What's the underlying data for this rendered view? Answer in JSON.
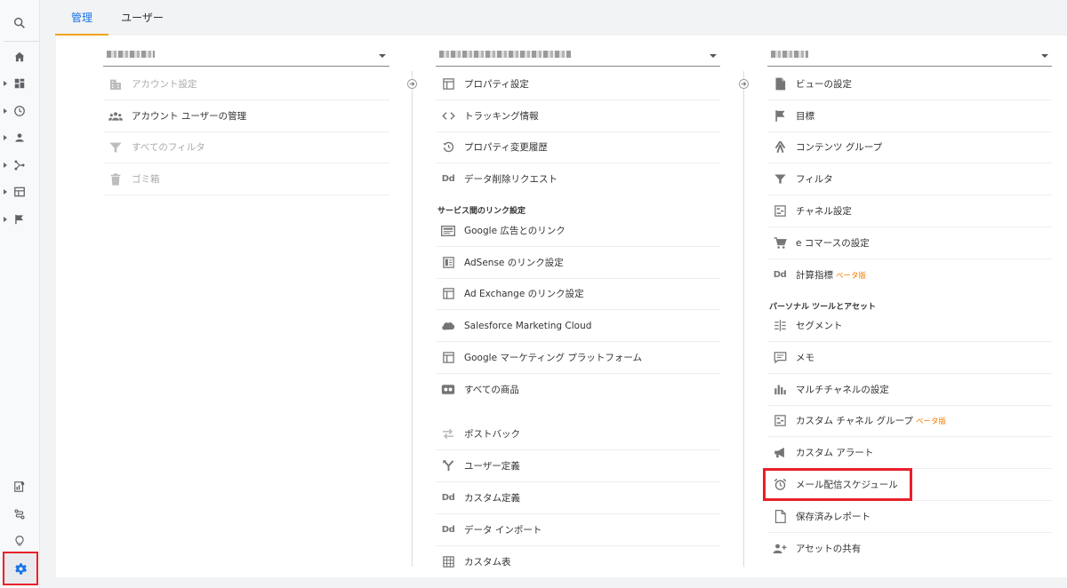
{
  "tabs": {
    "admin": "管理",
    "user": "ユーザー"
  },
  "colors": {
    "accent_blue": "#1a73e8",
    "tab_underline": "#f4a31c",
    "highlight_red": "#e8202a",
    "beta_orange": "#f57c00"
  },
  "rail": {
    "top": [
      "search-icon"
    ],
    "items": [
      "home-icon",
      "dashboard-icon",
      "clock-icon",
      "person-icon",
      "flow-icon",
      "table-icon",
      "flag-icon"
    ],
    "bottom": [
      "attribution-icon",
      "path-icon",
      "lightbulb-icon",
      "gear-icon"
    ]
  },
  "account": {
    "items": [
      {
        "label": "アカウント設定",
        "icon": "building-icon",
        "dim": true
      },
      {
        "label": "アカウント ユーザーの管理",
        "icon": "people-icon",
        "dim": false
      },
      {
        "label": "すべてのフィルタ",
        "icon": "filter-icon",
        "dim": true
      },
      {
        "label": "ゴミ箱",
        "icon": "trash-icon",
        "dim": true
      }
    ]
  },
  "property": {
    "items": [
      {
        "label": "プロパティ設定",
        "icon": "window-icon"
      },
      {
        "label": "トラッキング情報",
        "icon": "code-icon"
      },
      {
        "label": "プロパティ変更履歴",
        "icon": "history-icon"
      },
      {
        "label": "データ削除リクエスト",
        "icon": "dd-icon"
      }
    ],
    "section": "サービス間のリンク設定",
    "links": [
      {
        "label": "Google 広告とのリンク",
        "icon": "ads-icon"
      },
      {
        "label": "AdSense のリンク設定",
        "icon": "adsense-icon"
      },
      {
        "label": "Ad Exchange のリンク設定",
        "icon": "window-icon"
      },
      {
        "label": "Salesforce Marketing Cloud",
        "icon": "cloud-icon"
      },
      {
        "label": "Google マーケティング プラットフォーム",
        "icon": "window-icon"
      },
      {
        "label": "すべての商品",
        "icon": "products-icon"
      }
    ],
    "more": [
      {
        "label": "ポストバック",
        "icon": "swap-icon"
      },
      {
        "label": "ユーザー定義",
        "icon": "fork-icon"
      },
      {
        "label": "カスタム定義",
        "icon": "dd-icon"
      },
      {
        "label": "データ インポート",
        "icon": "dd-icon"
      },
      {
        "label": "カスタム表",
        "icon": "grid-icon"
      }
    ]
  },
  "view": {
    "items": [
      {
        "label": "ビューの設定",
        "icon": "doc-icon"
      },
      {
        "label": "目標",
        "icon": "flag-icon"
      },
      {
        "label": "コンテンツ グループ",
        "icon": "person-run-icon"
      },
      {
        "label": "フィルタ",
        "icon": "filter-icon"
      },
      {
        "label": "チャネル設定",
        "icon": "channel-icon"
      },
      {
        "label": "e コマースの設定",
        "icon": "cart-icon"
      },
      {
        "label": "計算指標",
        "icon": "dd-icon",
        "beta": "ベータ版"
      }
    ],
    "section": "パーソナル ツールとアセット",
    "tools": [
      {
        "label": "セグメント",
        "icon": "segment-icon"
      },
      {
        "label": "メモ",
        "icon": "comment-icon"
      },
      {
        "label": "マルチチャネルの設定",
        "icon": "bars-icon"
      },
      {
        "label": "カスタム チャネル グループ",
        "icon": "channel-icon",
        "beta": "ベータ版"
      },
      {
        "label": "カスタム アラート",
        "icon": "megaphone-icon"
      },
      {
        "label": "メール配信スケジュール",
        "icon": "alarm-icon"
      },
      {
        "label": "保存済みレポート",
        "icon": "file-icon"
      },
      {
        "label": "アセットの共有",
        "icon": "person-add-icon"
      }
    ]
  }
}
